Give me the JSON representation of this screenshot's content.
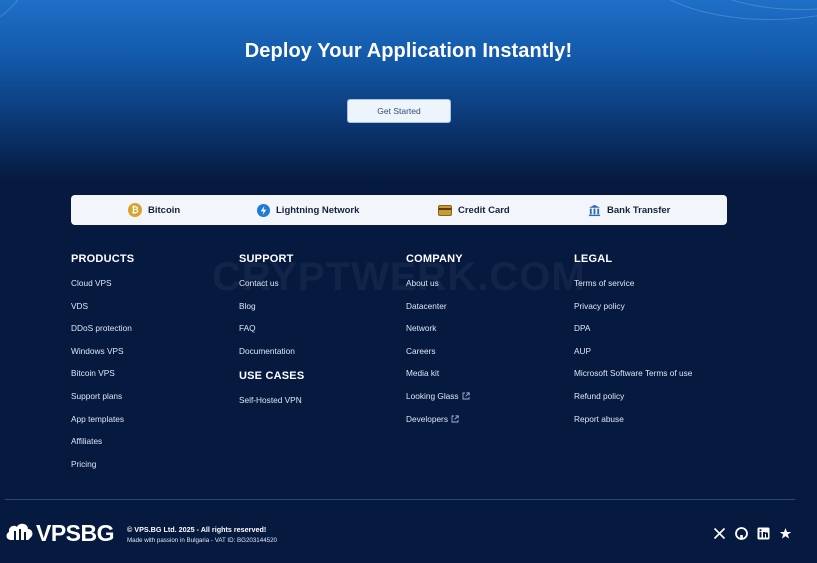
{
  "hero": {
    "title": "Deploy Your Application Instantly!",
    "cta_label": "Get Started"
  },
  "payments": [
    {
      "label": "Bitcoin",
      "icon": "bitcoin-icon"
    },
    {
      "label": "Lightning Network",
      "icon": "lightning-icon"
    },
    {
      "label": "Credit Card",
      "icon": "credit-card-icon"
    },
    {
      "label": "Bank Transfer",
      "icon": "bank-icon"
    }
  ],
  "footer": {
    "products": {
      "heading": "PRODUCTS",
      "links": [
        "Cloud VPS",
        "VDS",
        "DDoS protection",
        "Windows VPS",
        "Bitcoin VPS",
        "Support plans",
        "App templates",
        "Affiliates",
        "Pricing"
      ]
    },
    "support": {
      "heading": "SUPPORT",
      "links": [
        "Contact us",
        "Blog",
        "FAQ",
        "Documentation"
      ]
    },
    "use_cases": {
      "heading": "USE CASES",
      "links": [
        "Self-Hosted VPN"
      ]
    },
    "company": {
      "heading": "COMPANY",
      "links": [
        "About us",
        "Datacenter",
        "Network",
        "Careers",
        "Media kit",
        "Looking Glass",
        "Developers"
      ]
    },
    "legal": {
      "heading": "LEGAL",
      "links": [
        "Terms of service",
        "Privacy policy",
        "DPA",
        "AUP",
        "Microsoft Software Terms of use",
        "Refund policy",
        "Report abuse"
      ]
    }
  },
  "watermark": "CRYPTWERK.COM",
  "brand": {
    "logo_text": "VPSBG",
    "copyright": "© VPS.BG Ltd. 2025 - All rights reserved!",
    "tagline": "Made with passion in Bulgaria - VAT ID: BG203144520"
  },
  "social": [
    "x-icon",
    "github-icon",
    "linkedin-icon",
    "star-icon"
  ],
  "colors": {
    "background": "#061a40",
    "hero_top": "#1e6fc8",
    "bitcoin": "#d9a42c",
    "lightning": "#1f7ad6",
    "card": "#b88a2c",
    "bank": "#2a6db3"
  }
}
